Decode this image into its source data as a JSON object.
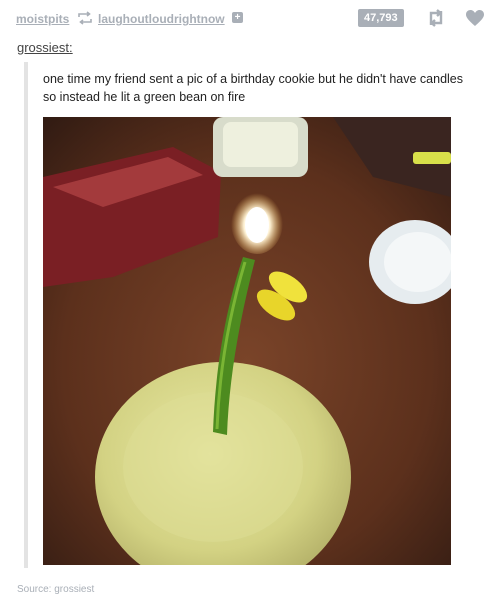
{
  "header": {
    "poster": "moistpits",
    "reblogged_from": "laughoutloudrightnow",
    "note_count": "47,793"
  },
  "post": {
    "op_name": "grossiest",
    "op_suffix": ":",
    "text": "one time my friend sent a pic of a birthday cookie but he didn't have candles so instead he lit a green bean on fire",
    "source_label": "Source: grossiest"
  },
  "colors": {
    "meta_gray": "#a9afb7",
    "quote_border": "#e3e3e3",
    "bean_green": "#4d8b1f",
    "cookie": "#d7d78a",
    "table": "#6a3a22"
  },
  "icons": [
    "reblog-icon",
    "add-icon",
    "reblog-icon",
    "heart-icon"
  ]
}
